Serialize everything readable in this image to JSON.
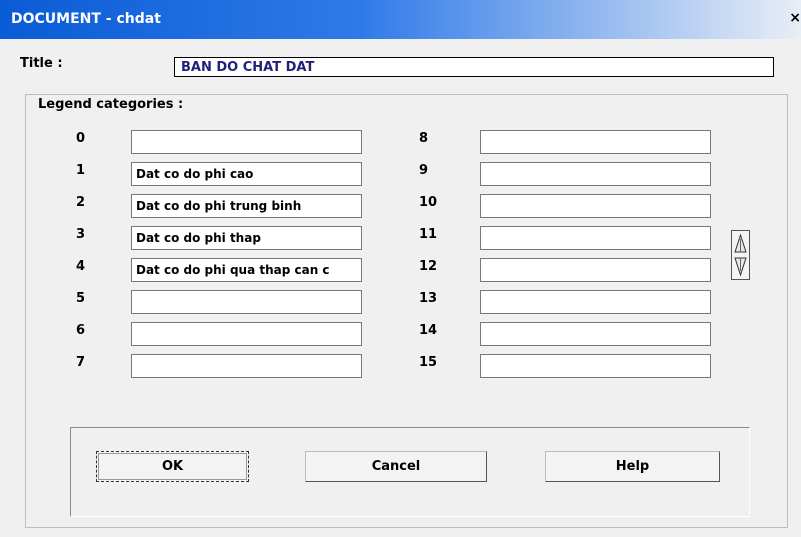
{
  "window": {
    "title": "DOCUMENT - chdat",
    "close_label": "×"
  },
  "title_label": "Title :",
  "title_value": "BAN DO CHAT DAT",
  "legend_label": "Legend categories :",
  "categories_left": [
    {
      "num": "0",
      "value": ""
    },
    {
      "num": "1",
      "value": "Dat co do phi cao"
    },
    {
      "num": "2",
      "value": "Dat co do phi trung binh"
    },
    {
      "num": "3",
      "value": "Dat co do phi thap"
    },
    {
      "num": "4",
      "value": "Dat co do phi qua thap can c"
    },
    {
      "num": "5",
      "value": ""
    },
    {
      "num": "6",
      "value": ""
    },
    {
      "num": "7",
      "value": ""
    }
  ],
  "categories_right": [
    {
      "num": "8",
      "value": ""
    },
    {
      "num": "9",
      "value": ""
    },
    {
      "num": "10",
      "value": ""
    },
    {
      "num": "11",
      "value": ""
    },
    {
      "num": "12",
      "value": ""
    },
    {
      "num": "13",
      "value": ""
    },
    {
      "num": "14",
      "value": ""
    },
    {
      "num": "15",
      "value": ""
    }
  ],
  "buttons": {
    "ok": "OK",
    "cancel": "Cancel",
    "help": "Help"
  }
}
